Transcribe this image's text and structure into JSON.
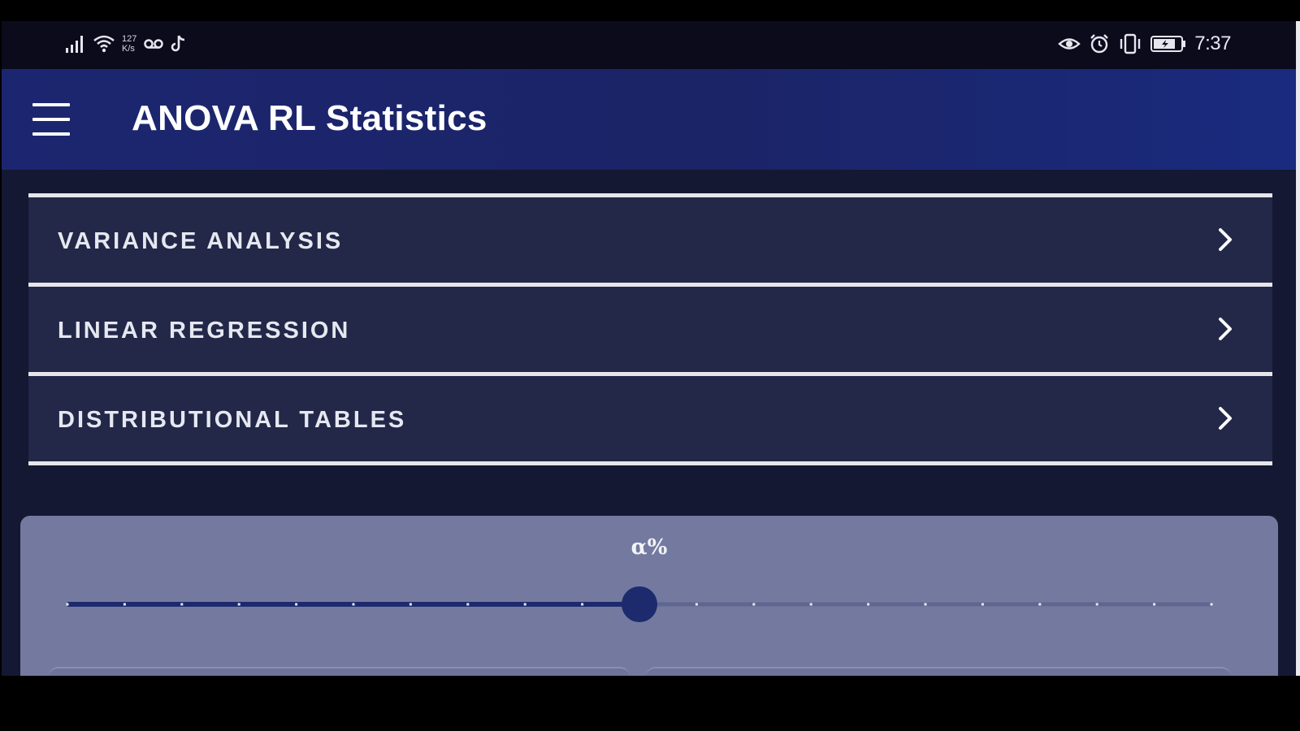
{
  "status_bar": {
    "network_speed_value": "127",
    "network_speed_unit": "K/s",
    "time": "7:37",
    "left_icons": [
      "signal-icon",
      "wifi-icon",
      "voicemail-icon",
      "tiktok-icon"
    ],
    "right_icons": [
      "eye-icon",
      "alarm-icon",
      "vibrate-icon",
      "battery-icon"
    ]
  },
  "appbar": {
    "title": "ANOVA RL Statistics",
    "menu_icon": "hamburger-menu-icon"
  },
  "nav": {
    "items": [
      {
        "label": "VARIANCE ANALYSIS",
        "icon": "chevron-right-icon"
      },
      {
        "label": "LINEAR REGRESSION",
        "icon": "chevron-right-icon"
      },
      {
        "label": "DISTRIBUTIONAL TABLES",
        "icon": "chevron-right-icon"
      }
    ]
  },
  "alpha": {
    "label": "α%",
    "slider": {
      "steps": 20,
      "value_fraction": 0.5
    }
  },
  "colors": {
    "background": "#141833",
    "appbar": "#1c2670",
    "nav_item": "#232849",
    "card": "#747a9f",
    "slider_active": "#1d2a6e",
    "slider_inactive": "#5f6690"
  }
}
